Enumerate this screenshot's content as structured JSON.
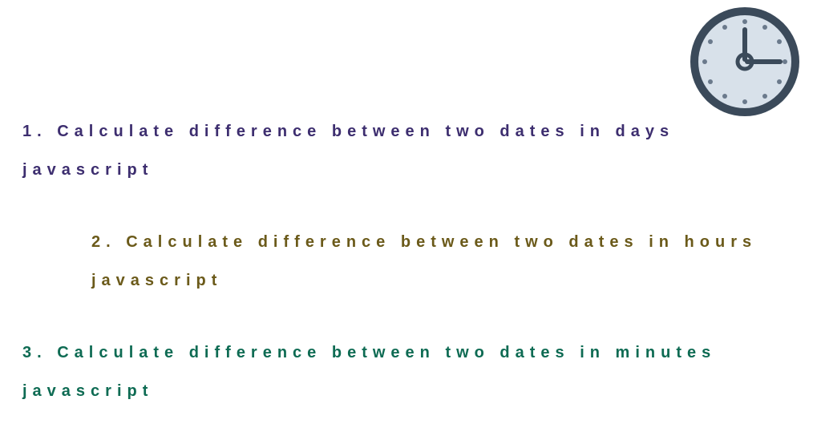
{
  "items": [
    "1. Calculate difference between two dates in days javascript",
    "2. Calculate difference between two dates in hours javascript",
    "3. Calculate difference between two dates in minutes javascript"
  ],
  "clock": {
    "time_semantic": "3:00",
    "face_fill": "#d8e1ea",
    "ring": "#3b4a5a",
    "hand": "#3b4a5a",
    "tick": "#6b7a8c"
  }
}
